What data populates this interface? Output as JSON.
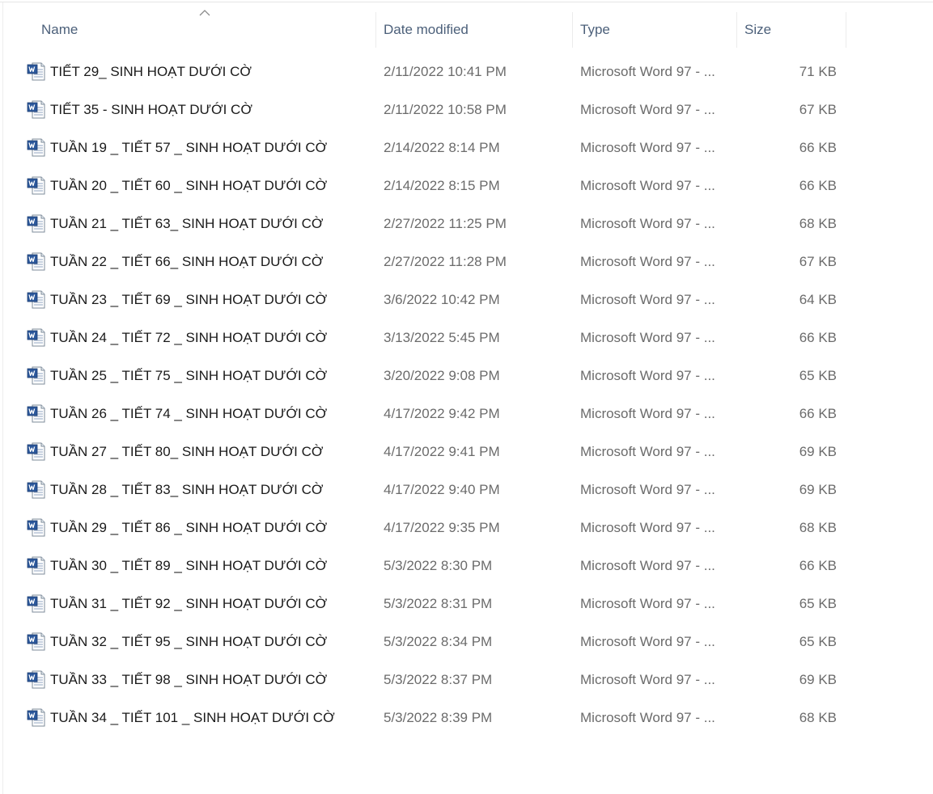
{
  "columns": {
    "name": "Name",
    "date": "Date modified",
    "type": "Type",
    "size": "Size"
  },
  "sort": {
    "column": "Name",
    "icon": "sort-up-chevron-icon"
  },
  "file_icon": "word-document-icon",
  "files": [
    {
      "name": "TIẾT 29_ SINH HOẠT DƯỚI CỜ",
      "date": "2/11/2022 10:41 PM",
      "type": "Microsoft Word 97 - ...",
      "size": "71 KB"
    },
    {
      "name": "TIẾT 35 - SINH HOẠT DƯỚI CỜ",
      "date": "2/11/2022 10:58 PM",
      "type": "Microsoft Word 97 - ...",
      "size": "67 KB"
    },
    {
      "name": "TUẦN 19 _ TIẾT 57 _ SINH HOẠT DƯỚI CỜ",
      "date": "2/14/2022 8:14 PM",
      "type": "Microsoft Word 97 - ...",
      "size": "66 KB"
    },
    {
      "name": "TUẦN 20 _ TIẾT 60 _ SINH HOẠT DƯỚI CỜ",
      "date": "2/14/2022 8:15 PM",
      "type": "Microsoft Word 97 - ...",
      "size": "66 KB"
    },
    {
      "name": "TUẦN 21 _ TIẾT 63_ SINH HOẠT DƯỚI CỜ",
      "date": "2/27/2022 11:25 PM",
      "type": "Microsoft Word 97 - ...",
      "size": "68 KB"
    },
    {
      "name": "TUẦN 22 _ TIẾT 66_ SINH HOẠT DƯỚI CỜ",
      "date": "2/27/2022 11:28 PM",
      "type": "Microsoft Word 97 - ...",
      "size": "67 KB"
    },
    {
      "name": "TUẦN 23 _ TIẾT 69 _ SINH HOẠT DƯỚI CỜ",
      "date": "3/6/2022 10:42 PM",
      "type": "Microsoft Word 97 - ...",
      "size": "64 KB"
    },
    {
      "name": "TUẦN 24 _ TIẾT 72 _ SINH HOẠT DƯỚI CỜ",
      "date": "3/13/2022 5:45 PM",
      "type": "Microsoft Word 97 - ...",
      "size": "66 KB"
    },
    {
      "name": "TUẦN 25 _ TIẾT 75 _ SINH HOẠT DƯỚI CỜ",
      "date": "3/20/2022 9:08 PM",
      "type": "Microsoft Word 97 - ...",
      "size": "65 KB"
    },
    {
      "name": "TUẦN 26 _ TIẾT 74 _ SINH HOẠT DƯỚI CỜ",
      "date": "4/17/2022 9:42 PM",
      "type": "Microsoft Word 97 - ...",
      "size": "66 KB"
    },
    {
      "name": "TUẦN 27 _ TIẾT 80_ SINH HOẠT DƯỚI CỜ",
      "date": "4/17/2022 9:41 PM",
      "type": "Microsoft Word 97 - ...",
      "size": "69 KB"
    },
    {
      "name": "TUẦN 28 _ TIẾT 83_ SINH HOẠT DƯỚI CỜ",
      "date": "4/17/2022 9:40 PM",
      "type": "Microsoft Word 97 - ...",
      "size": "69 KB"
    },
    {
      "name": "TUẦN 29 _ TIẾT  86 _ SINH HOẠT DƯỚI CỜ",
      "date": "4/17/2022 9:35 PM",
      "type": "Microsoft Word 97 - ...",
      "size": "68 KB"
    },
    {
      "name": "TUẦN 30 _ TIẾT 89 _ SINH HOẠT DƯỚI CỜ",
      "date": "5/3/2022 8:30 PM",
      "type": "Microsoft Word 97 - ...",
      "size": "66 KB"
    },
    {
      "name": "TUẦN 31 _ TIẾT 92 _ SINH HOẠT DƯỚI CỜ",
      "date": "5/3/2022 8:31 PM",
      "type": "Microsoft Word 97 - ...",
      "size": "65 KB"
    },
    {
      "name": "TUẦN 32 _ TIẾT 95 _ SINH HOẠT DƯỚI CỜ",
      "date": "5/3/2022 8:34 PM",
      "type": "Microsoft Word 97 - ...",
      "size": "65 KB"
    },
    {
      "name": "TUẦN 33 _ TIẾT 98 _ SINH HOẠT DƯỚI CỜ",
      "date": "5/3/2022 8:37 PM",
      "type": "Microsoft Word 97 - ...",
      "size": "69 KB"
    },
    {
      "name": "TUẦN 34 _ TIẾT 101 _ SINH HOẠT DƯỚI CỜ",
      "date": "5/3/2022 8:39 PM",
      "type": "Microsoft Word 97 - ...",
      "size": "68 KB"
    }
  ]
}
